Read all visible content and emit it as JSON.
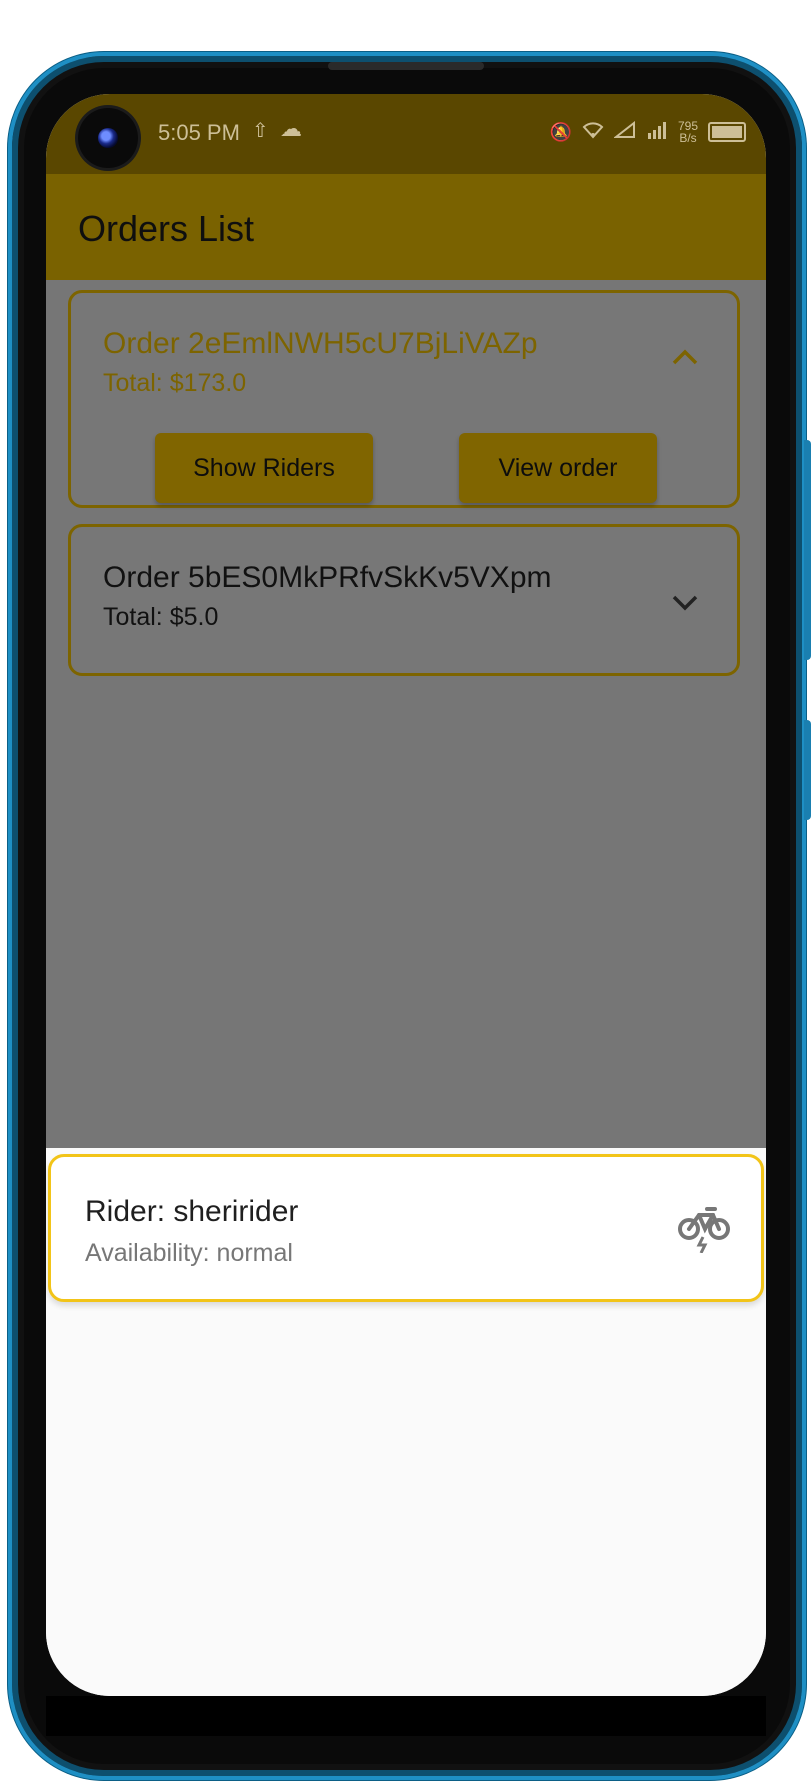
{
  "status_bar": {
    "time": "5:05 PM",
    "net_speed_value": "795",
    "net_speed_unit": "B/s"
  },
  "app_bar": {
    "title": "Orders List"
  },
  "orders": [
    {
      "title": "Order 2eEmlNWH5cU7BjLiVAZp",
      "total": "Total: $173.0",
      "expanded": true,
      "actions": {
        "show_riders": "Show Riders",
        "view_order": "View order"
      }
    },
    {
      "title": "Order 5bES0MkPRfvSkKv5VXpm",
      "total": "Total: $5.0",
      "expanded": false
    }
  ],
  "rider_sheet": {
    "rider": {
      "name": "Rider: sheririder",
      "availability": "Availability: normal",
      "icon": "bike-icon"
    }
  },
  "colors": {
    "accent": "#f2c418",
    "app_bar_dimmed": "#7a6200",
    "overlay_bg": "#767676"
  }
}
